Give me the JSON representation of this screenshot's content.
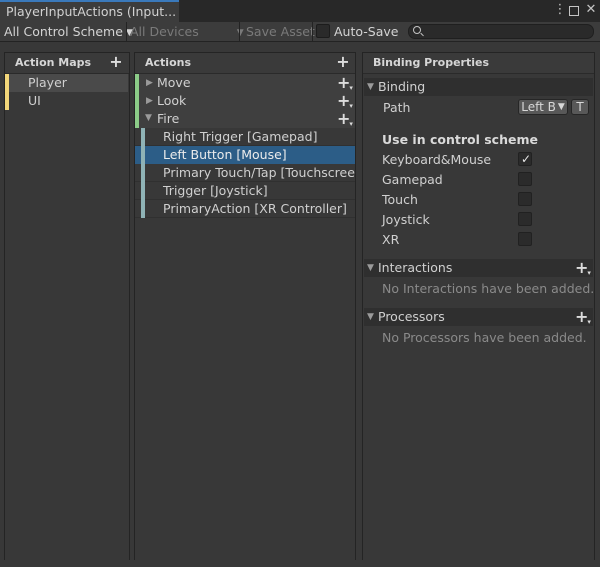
{
  "window": {
    "tab_title": "PlayerInputActions (Input...",
    "menu_icon": "kebab-menu-icon",
    "close_icon": "close-icon"
  },
  "toolbar": {
    "control_scheme": "All Control Scheme",
    "devices": "All Devices",
    "save_asset": "Save Asset",
    "auto_save": "Auto-Save",
    "auto_save_checked": false,
    "search_value": ""
  },
  "action_maps": {
    "header": "Action Maps",
    "items": [
      {
        "label": "Player",
        "selected": true
      },
      {
        "label": "UI",
        "selected": false
      }
    ]
  },
  "actions": {
    "header": "Actions",
    "items": [
      {
        "label": "Move",
        "expanded": false
      },
      {
        "label": "Look",
        "expanded": false
      },
      {
        "label": "Fire",
        "expanded": true
      }
    ],
    "bindings": [
      {
        "label": "Right Trigger [Gamepad]",
        "selected": false
      },
      {
        "label": "Left Button [Mouse]",
        "selected": true
      },
      {
        "label": "Primary Touch/Tap [Touchscreen]",
        "selected": false
      },
      {
        "label": "Trigger [Joystick]",
        "selected": false
      },
      {
        "label": "PrimaryAction [XR Controller]",
        "selected": false
      }
    ]
  },
  "properties": {
    "header": "Binding Properties",
    "binding_section": "Binding",
    "path_label": "Path",
    "path_value": "Left B",
    "t_button": "T",
    "scheme_title": "Use in control scheme",
    "schemes": [
      {
        "label": "Keyboard&Mouse",
        "checked": true
      },
      {
        "label": "Gamepad",
        "checked": false
      },
      {
        "label": "Touch",
        "checked": false
      },
      {
        "label": "Joystick",
        "checked": false
      },
      {
        "label": "XR",
        "checked": false
      }
    ],
    "interactions_section": "Interactions",
    "interactions_empty": "No Interactions have been added.",
    "processors_section": "Processors",
    "processors_empty": "No Processors have been added."
  },
  "colors": {
    "accent": "#3a79bb",
    "map_stripe": "#f3d77a",
    "action_stripe": "#8ccc88",
    "binding_stripe": "#8fb3b6",
    "selection": "#2c5d87"
  }
}
